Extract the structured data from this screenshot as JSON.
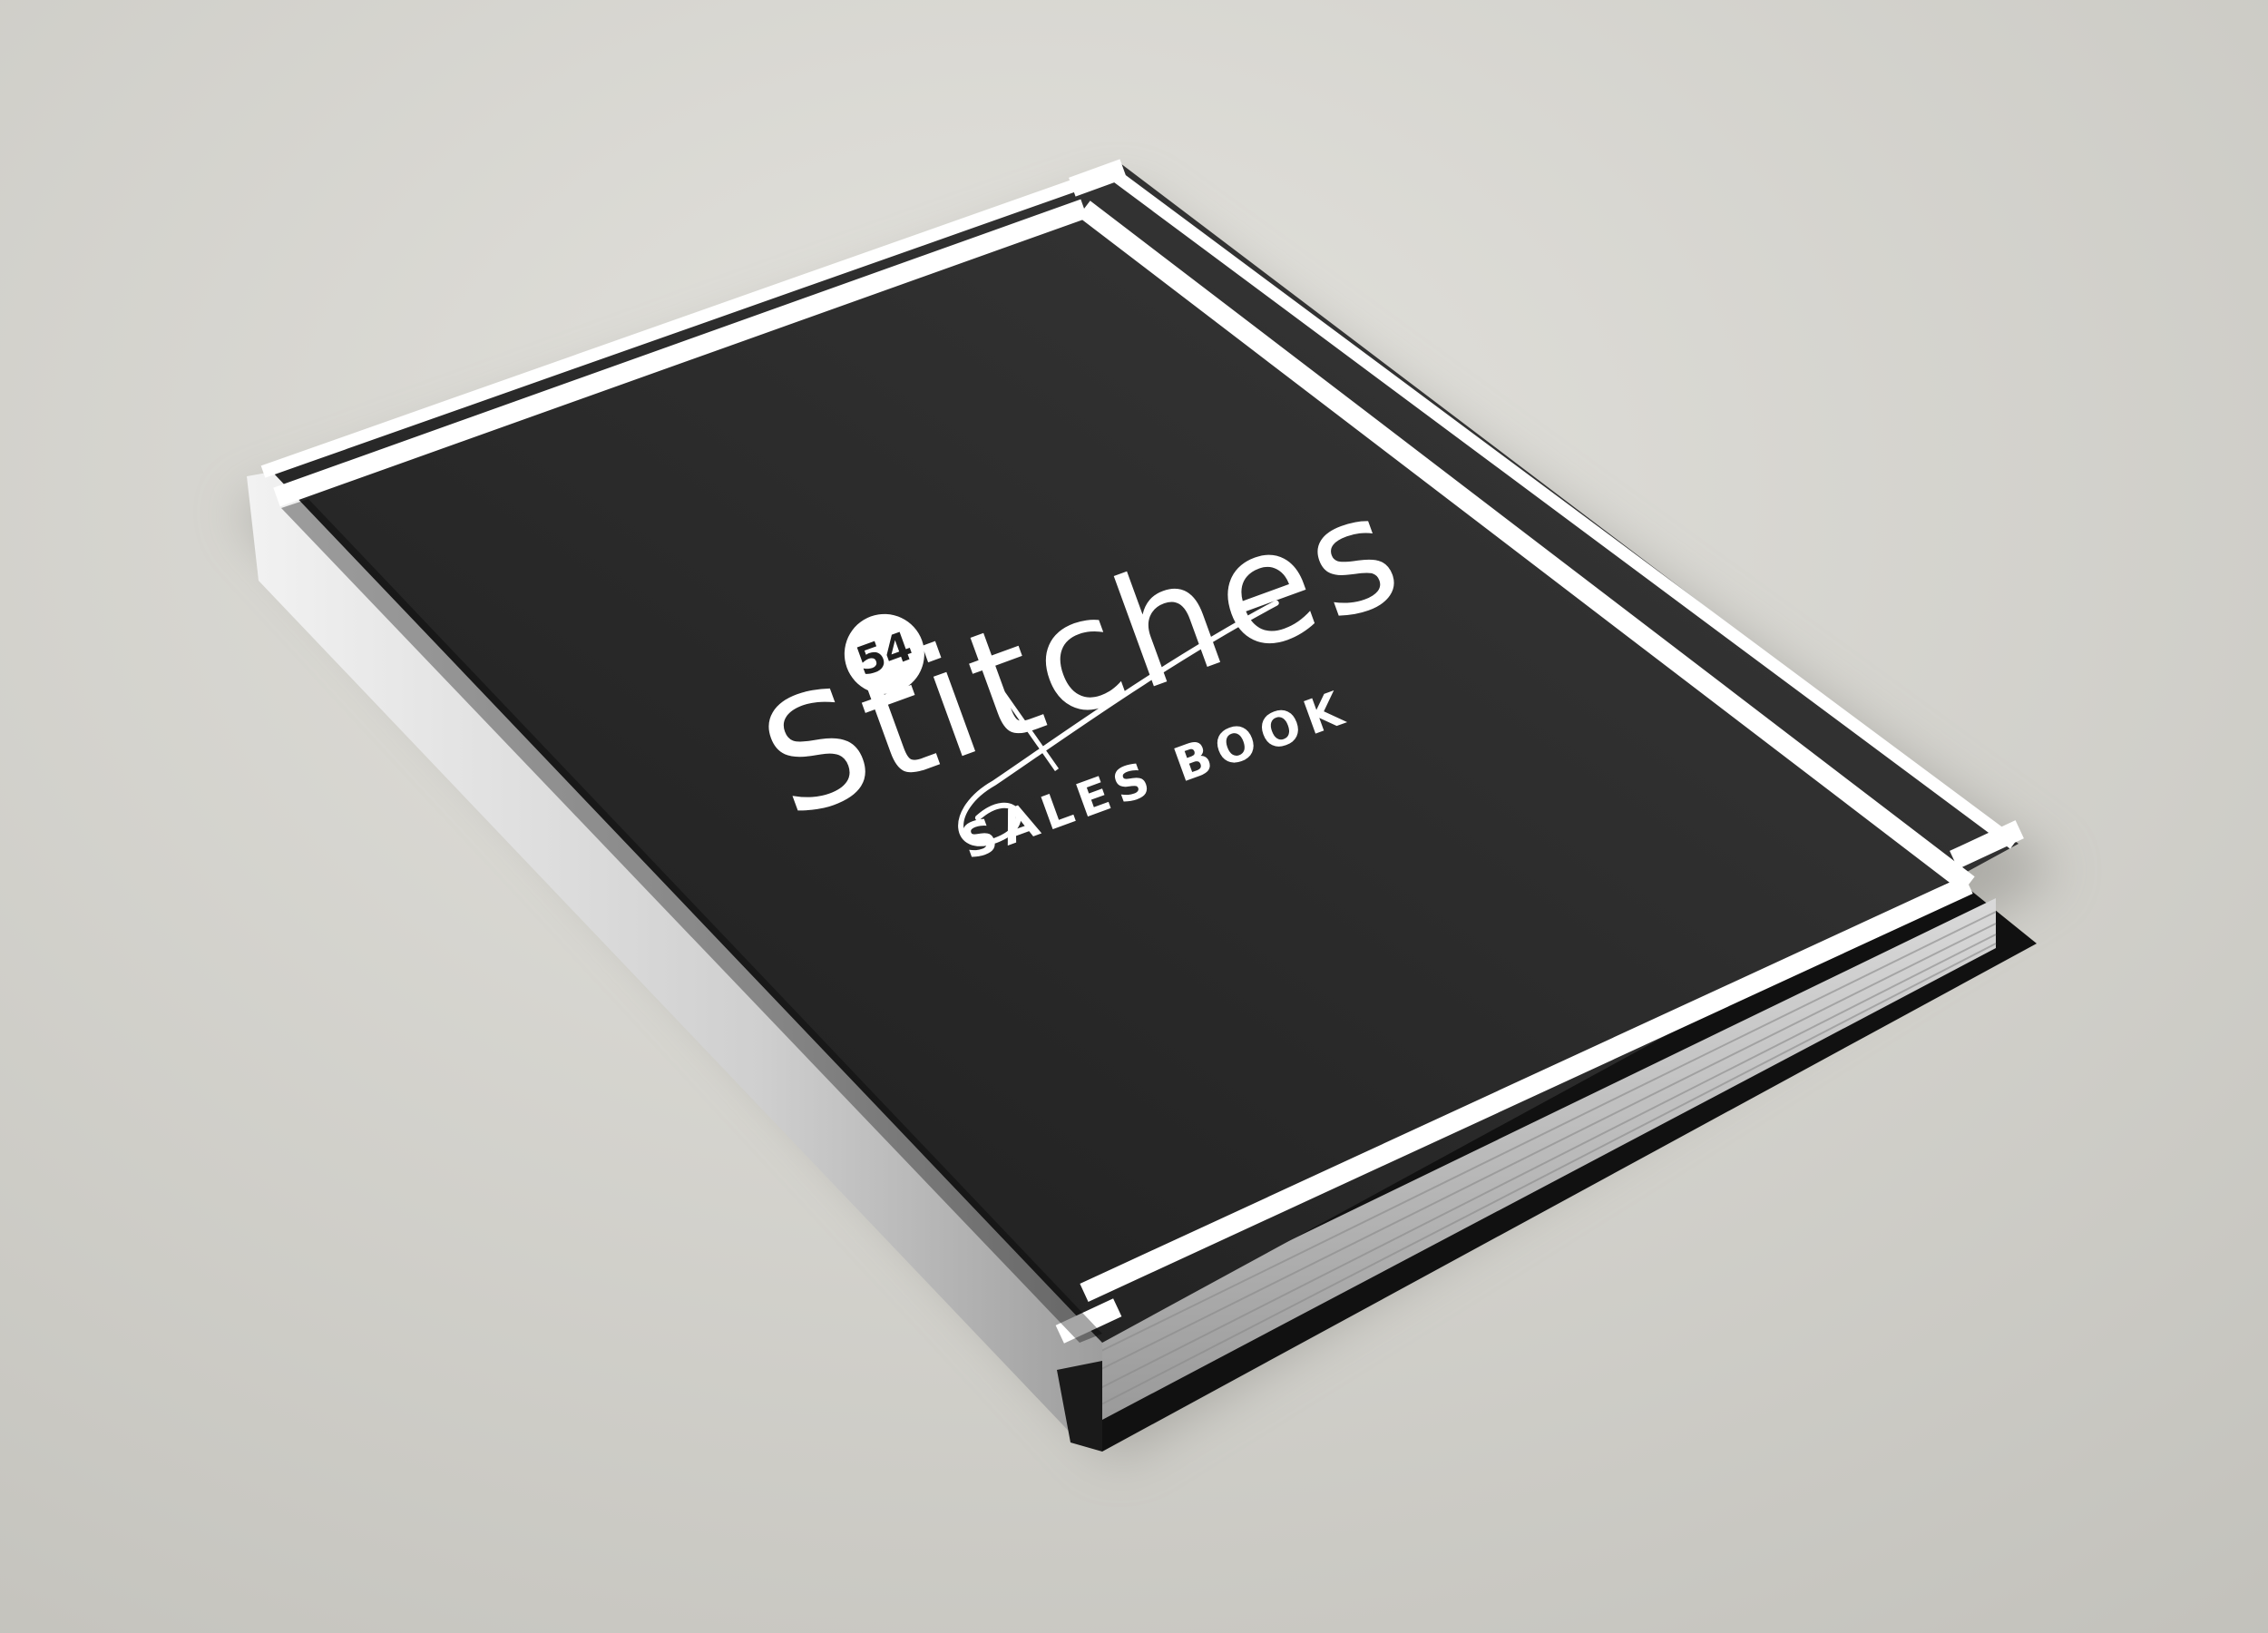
{
  "book": {
    "brand": {
      "badge_number": "54",
      "wordmark": "Stitches"
    },
    "subtitle": "SALES BOOK"
  },
  "colors": {
    "background_light": "#e2e1dc",
    "background_dark": "#c4c3bd",
    "cover": "#1f1f1f",
    "cover_highlight": "#3a3a3a",
    "border": "#ffffff",
    "pages": "#bdbdbd"
  }
}
